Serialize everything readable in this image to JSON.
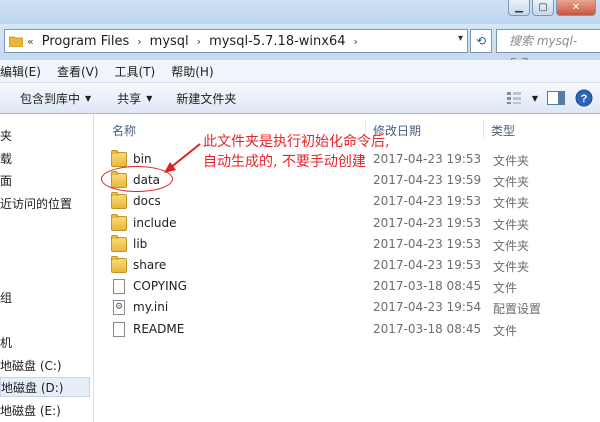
{
  "address": {
    "overflow": "«",
    "crumbs": [
      "Program Files",
      "mysql",
      "mysql-5.7.18-winx64"
    ],
    "separator": "›"
  },
  "search": {
    "placeholder": "搜索 mysql-5.7..."
  },
  "menu": {
    "items": [
      "编辑(E)",
      "查看(V)",
      "工具(T)",
      "帮助(H)"
    ]
  },
  "toolbar": {
    "include_label": "包含到库中",
    "share_label": "共享",
    "new_folder_label": "新建文件夹"
  },
  "nav": {
    "items": [
      "夹",
      "载",
      "面",
      "近访问的位置",
      "组",
      "机",
      "地磁盘 (C:)",
      "地磁盘 (D:)",
      "地磁盘 (E:)"
    ]
  },
  "columns": {
    "name": "名称",
    "modified": "修改日期",
    "type": "类型"
  },
  "files": [
    {
      "name": "bin",
      "date": "2017-04-23 19:53",
      "type": "文件夹",
      "kind": "folder"
    },
    {
      "name": "data",
      "date": "2017-04-23 19:59",
      "type": "文件夹",
      "kind": "folder"
    },
    {
      "name": "docs",
      "date": "2017-04-23 19:53",
      "type": "文件夹",
      "kind": "folder"
    },
    {
      "name": "include",
      "date": "2017-04-23 19:53",
      "type": "文件夹",
      "kind": "folder"
    },
    {
      "name": "lib",
      "date": "2017-04-23 19:53",
      "type": "文件夹",
      "kind": "folder"
    },
    {
      "name": "share",
      "date": "2017-04-23 19:53",
      "type": "文件夹",
      "kind": "folder"
    },
    {
      "name": "COPYING",
      "date": "2017-03-18 08:45",
      "type": "文件",
      "kind": "file"
    },
    {
      "name": "my.ini",
      "date": "2017-04-23 19:54",
      "type": "配置设置",
      "kind": "ini"
    },
    {
      "name": "README",
      "date": "2017-03-18 08:45",
      "type": "文件",
      "kind": "file"
    }
  ],
  "annotation": {
    "line1": "此文件夹是执行初始化命令后,",
    "line2": "自动生成的, 不要手动创建",
    "color": "#e8242a"
  },
  "icons": {
    "refresh": "refresh-icon",
    "views": "view-options-icon",
    "preview": "preview-pane-icon",
    "help": "help-icon"
  }
}
